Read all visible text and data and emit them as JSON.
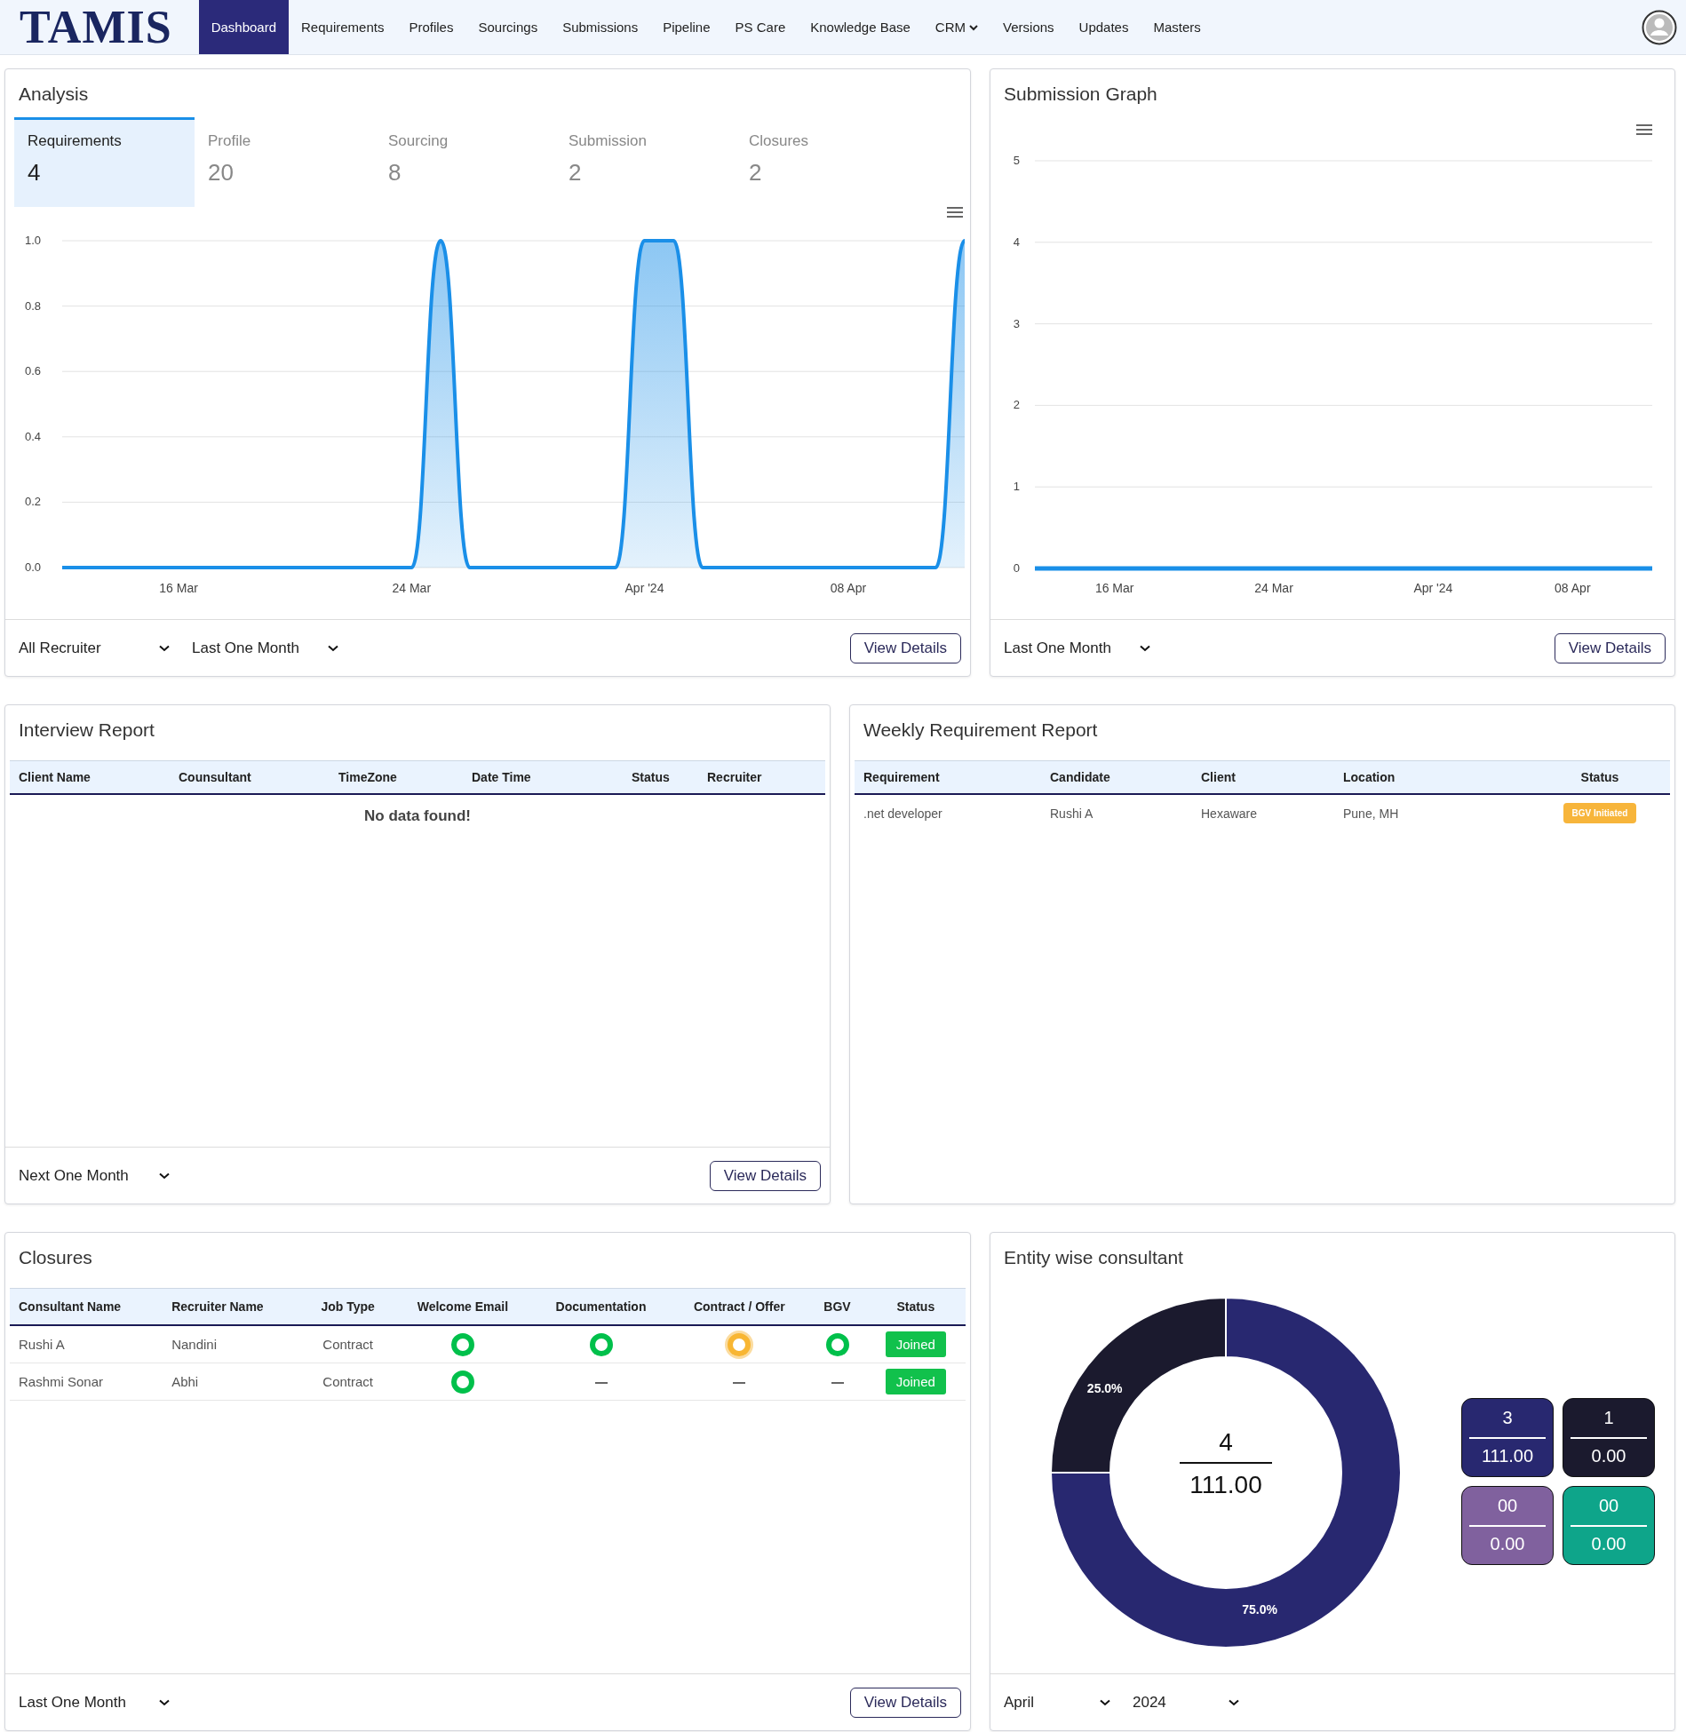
{
  "nav": {
    "logo": "TAMIS",
    "items": [
      {
        "label": "Dashboard",
        "selected": true,
        "dropdown": false
      },
      {
        "label": "Requirements",
        "selected": false,
        "dropdown": false
      },
      {
        "label": "Profiles",
        "selected": false,
        "dropdown": false
      },
      {
        "label": "Sourcings",
        "selected": false,
        "dropdown": false
      },
      {
        "label": "Submissions",
        "selected": false,
        "dropdown": false
      },
      {
        "label": "Pipeline",
        "selected": false,
        "dropdown": false
      },
      {
        "label": "PS Care",
        "selected": false,
        "dropdown": false
      },
      {
        "label": "Knowledge Base",
        "selected": false,
        "dropdown": false
      },
      {
        "label": "CRM",
        "selected": false,
        "dropdown": true
      },
      {
        "label": "Versions",
        "selected": false,
        "dropdown": false
      },
      {
        "label": "Updates",
        "selected": false,
        "dropdown": false
      },
      {
        "label": "Masters",
        "selected": false,
        "dropdown": false
      }
    ]
  },
  "analysis": {
    "title": "Analysis",
    "tabs": [
      {
        "label": "Requirements",
        "count": "4",
        "selected": true
      },
      {
        "label": "Profile",
        "count": "20",
        "selected": false
      },
      {
        "label": "Sourcing",
        "count": "8",
        "selected": false
      },
      {
        "label": "Submission",
        "count": "2",
        "selected": false
      },
      {
        "label": "Closures",
        "count": "2",
        "selected": false
      }
    ],
    "chart_data": {
      "type": "area",
      "categories": [
        null,
        null,
        null,
        null,
        "16 Mar",
        null,
        null,
        null,
        null,
        null,
        null,
        null,
        "24 Mar",
        null,
        null,
        null,
        null,
        null,
        null,
        null,
        "Apr '24",
        null,
        null,
        null,
        null,
        null,
        null,
        "08 Apr",
        null,
        null,
        null,
        null
      ],
      "series": [
        {
          "color": "#1a8fe8",
          "values": [
            0,
            0,
            0,
            0,
            0,
            0,
            0,
            0,
            0,
            0,
            0,
            0,
            0,
            1,
            0,
            0,
            0,
            0,
            0,
            0,
            1,
            1,
            0,
            0,
            0,
            0,
            0,
            0,
            0,
            0,
            0,
            1
          ]
        }
      ],
      "ylim": [
        0,
        1
      ],
      "grid": true,
      "yticks": [
        {
          "value": 0,
          "label": "0.0"
        },
        {
          "value": 0.2,
          "label": "0.2"
        },
        {
          "value": 0.4,
          "label": "0.4"
        },
        {
          "value": 0.6,
          "label": "0.6"
        },
        {
          "value": 0.8,
          "label": "0.8"
        },
        {
          "value": 1,
          "label": "1.0"
        }
      ]
    },
    "filters": [
      "All Recruiter",
      "Last One Month"
    ],
    "button": "View Details"
  },
  "submission_graph": {
    "title": "Submission Graph",
    "chart_data": {
      "type": "line",
      "categories": [
        null,
        null,
        null,
        null,
        "16 Mar",
        null,
        null,
        null,
        null,
        null,
        null,
        null,
        "24 Mar",
        null,
        null,
        null,
        null,
        null,
        null,
        null,
        "Apr '24",
        null,
        null,
        null,
        null,
        null,
        null,
        "08 Apr",
        null,
        null,
        null,
        null
      ],
      "series": [
        {
          "color": "#1a8fe8",
          "values": [
            0,
            0,
            0,
            0,
            0,
            0,
            0,
            0,
            0,
            0,
            0,
            0,
            0,
            0,
            0,
            0,
            0,
            0,
            0,
            0,
            0,
            0,
            0,
            0,
            0,
            0,
            0,
            0,
            0,
            0,
            0,
            0
          ]
        }
      ],
      "ylim": [
        0,
        5
      ],
      "grid": true,
      "yticks": [
        0,
        1,
        2,
        3,
        4,
        5
      ]
    },
    "filters": [
      "Last One Month"
    ],
    "button": "View Details"
  },
  "interview_report": {
    "title": "Interview Report",
    "columns": [
      "Client Name",
      "Counsultant",
      "TimeZone",
      "Date Time",
      "Status",
      "Recruiter"
    ],
    "empty_message": "No data found!",
    "filters": [
      "Next One Month"
    ],
    "button": "View Details"
  },
  "weekly_report": {
    "title": "Weekly Requirement Report",
    "columns": [
      "Requirement",
      "Candidate",
      "Client",
      "Location",
      "Status"
    ],
    "rows": [
      {
        "requirement": ".net developer",
        "candidate": "Rushi A",
        "client": "Hexaware",
        "location": "Pune, MH",
        "status": "BGV Initiated"
      }
    ]
  },
  "closures": {
    "title": "Closures",
    "columns": [
      "Consultant Name",
      "Recruiter Name",
      "Job Type",
      "Welcome Email",
      "Documentation",
      "Contract / Offer",
      "BGV",
      "Status"
    ],
    "rows": [
      {
        "consultant": "Rushi A",
        "recruiter": "Nandini",
        "job_type": "Contract",
        "steps": [
          {
            "kind": "done"
          },
          {
            "kind": "done"
          },
          {
            "kind": "pending"
          },
          {
            "kind": "done"
          }
        ],
        "status": "Joined"
      },
      {
        "consultant": "Rashmi Sonar",
        "recruiter": "Abhi",
        "job_type": "Contract",
        "steps": [
          {
            "kind": "done"
          },
          {
            "kind": "none"
          },
          {
            "kind": "none"
          },
          {
            "kind": "none"
          }
        ],
        "status": "Joined"
      }
    ],
    "filters": [
      "Last One Month"
    ],
    "button": "View Details"
  },
  "entity": {
    "title": "Entity wise consultant",
    "chart_data": {
      "type": "donut",
      "values": [
        75,
        25
      ],
      "colors": [
        "#282870",
        "#1b1a2e"
      ],
      "value_labels": [
        "75.0%",
        "25.0%"
      ]
    },
    "center": {
      "count": "4",
      "amount": "111.00"
    },
    "tiles": [
      {
        "count": "3",
        "amount": "111.00",
        "color": "#282870"
      },
      {
        "count": "1",
        "amount": "0.00",
        "color": "#1b1a2e"
      },
      {
        "count": "00",
        "amount": "0.00",
        "color": "#80619e"
      },
      {
        "count": "00",
        "amount": "0.00",
        "color": "#0ea58a"
      }
    ],
    "filters": [
      "April",
      "2024"
    ]
  }
}
